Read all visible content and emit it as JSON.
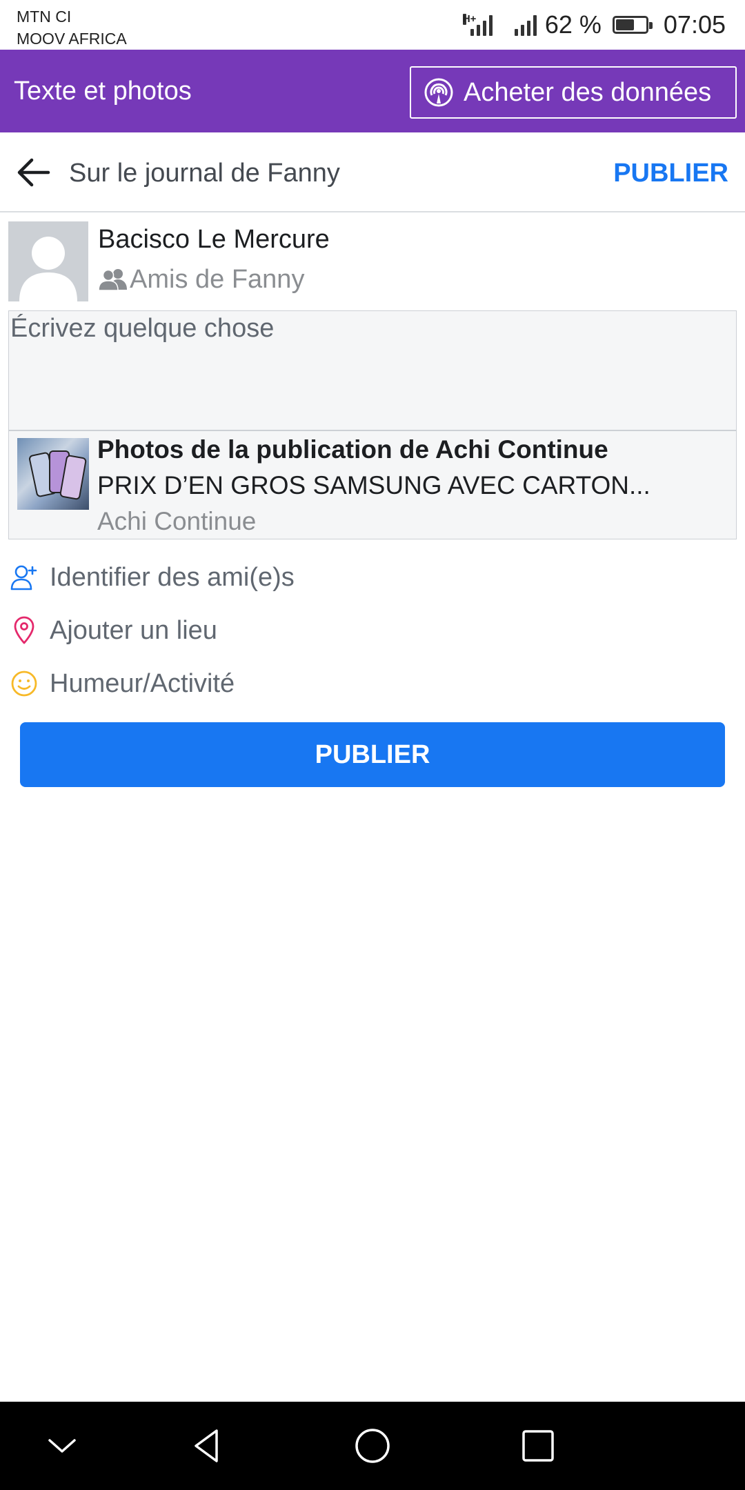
{
  "status_bar": {
    "carrier1": "MTN CI",
    "carrier2": "MOOV AFRICA",
    "network_type": "H+",
    "battery_percent": "62 %",
    "battery_level": 0.62,
    "time": "07:05"
  },
  "data_bar": {
    "title": "Texte et photos",
    "buy_button_label": "Acheter des données"
  },
  "header": {
    "title": "Sur le journal de Fanny",
    "publish_label": "PUBLIER"
  },
  "author": {
    "name": "Bacisco Le Mercure",
    "audience": "Amis de Fanny"
  },
  "composer": {
    "placeholder": "Écrivez quelque chose",
    "value": ""
  },
  "shared_post": {
    "title": "Photos de la publication de Achi Continue",
    "description": "PRIX D’EN GROS SAMSUNG AVEC CARTON...",
    "source": "Achi Continue"
  },
  "options": [
    {
      "label": "Identifier des ami(e)s",
      "icon": "add-person-icon",
      "color": "#1877f2"
    },
    {
      "label": "Ajouter un lieu",
      "icon": "location-pin-icon",
      "color": "#e4286b"
    },
    {
      "label": "Humeur/Activité",
      "icon": "smiley-icon",
      "color": "#f7b928"
    }
  ],
  "publish_button_label": "PUBLIER",
  "colors": {
    "accent": "#1877f2",
    "data_bar": "#7639b8"
  }
}
